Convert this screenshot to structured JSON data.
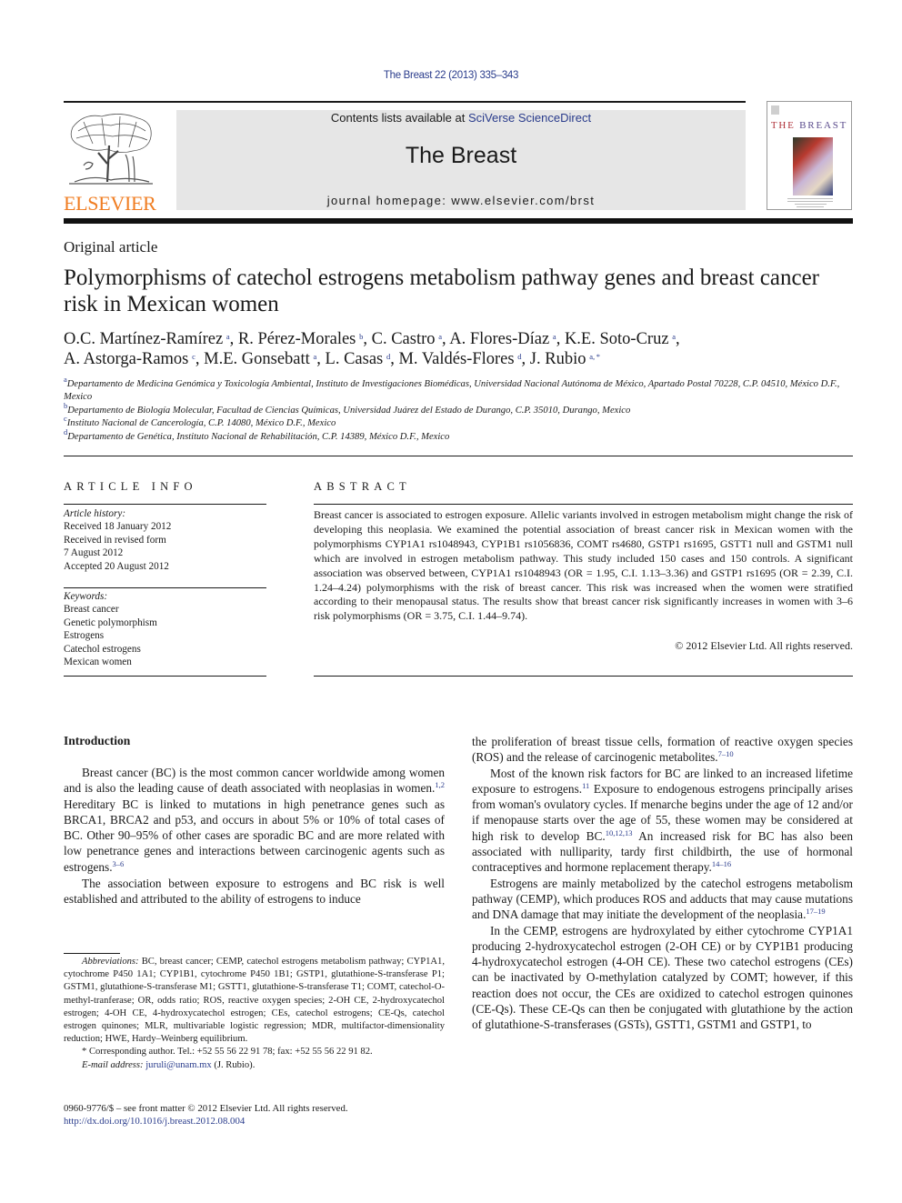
{
  "header": {
    "citation": "The Breast 22 (2013) 335–343",
    "contents_prefix": "Contents lists available at ",
    "contents_link": "SciVerse ScienceDirect",
    "journal_title": "The Breast",
    "homepage": "journal homepage: www.elsevier.com/brst",
    "publisher_logo_text": "ELSEVIER",
    "cover_title_first": "T",
    "cover_title_rest_red": "HE",
    "cover_title_blue": " BREAST",
    "colors": {
      "publisher_orange": "#f07d22",
      "link_blue": "#2a3c8c",
      "banner_gray": "#e6e6e6"
    }
  },
  "article": {
    "type": "Original article",
    "title": "Polymorphisms of catechol estrogens metabolism pathway genes and breast cancer risk in Mexican women",
    "authors": [
      {
        "name": "O.C. Martínez-Ramírez",
        "aff": "a",
        "sep": ", "
      },
      {
        "name": "R. Pérez-Morales",
        "aff": "b",
        "sep": ", "
      },
      {
        "name": "C. Castro",
        "aff": "a",
        "sep": ", "
      },
      {
        "name": "A. Flores-Díaz",
        "aff": "a",
        "sep": ", "
      },
      {
        "name": "K.E. Soto-Cruz",
        "aff": "a",
        "sep": ","
      },
      {
        "name": "A. Astorga-Ramos",
        "aff": "c",
        "sep": ", "
      },
      {
        "name": "M.E. Gonsebatt",
        "aff": "a",
        "sep": ", "
      },
      {
        "name": "L. Casas",
        "aff": "d",
        "sep": ", "
      },
      {
        "name": "M. Valdés-Flores",
        "aff": "d",
        "sep": ", "
      },
      {
        "name": "J. Rubio",
        "aff": "a, *",
        "sep": ""
      }
    ],
    "affiliations": [
      {
        "key": "a",
        "text": "Departamento de Medicina Genómica y Toxicología Ambiental, Instituto de Investigaciones Biomédicas, Universidad Nacional Autónoma de México, Apartado Postal 70228, C.P. 04510, México D.F., Mexico"
      },
      {
        "key": "b",
        "text": "Departamento de Biología Molecular, Facultad de Ciencias Químicas, Universidad Juárez del Estado de Durango, C.P. 35010, Durango, Mexico"
      },
      {
        "key": "c",
        "text": "Instituto Nacional de Cancerología, C.P. 14080, México D.F., Mexico"
      },
      {
        "key": "d",
        "text": "Departamento de Genética, Instituto Nacional de Rehabilitación, C.P. 14389, México D.F., Mexico"
      }
    ]
  },
  "article_info": {
    "heading": "ARTICLE INFO",
    "history_label": "Article history:",
    "history": [
      "Received 18 January 2012",
      "Received in revised form",
      "7 August 2012",
      "Accepted 20 August 2012"
    ],
    "keywords_label": "Keywords:",
    "keywords": [
      "Breast cancer",
      "Genetic polymorphism",
      "Estrogens",
      "Catechol estrogens",
      "Mexican women"
    ]
  },
  "abstract": {
    "heading": "ABSTRACT",
    "text": "Breast cancer is associated to estrogen exposure. Allelic variants involved in estrogen metabolism might change the risk of developing this neoplasia. We examined the potential association of breast cancer risk in Mexican women with the polymorphisms CYP1A1 rs1048943, CYP1B1 rs1056836, COMT rs4680, GSTP1 rs1695, GSTT1 null and GSTM1 null which are involved in estrogen metabolism pathway. This study included 150 cases and 150 controls. A significant association was observed between, CYP1A1 rs1048943 (OR = 1.95, C.I. 1.13–3.36) and GSTP1 rs1695 (OR = 2.39, C.I. 1.24–4.24) polymorphisms with the risk of breast cancer. This risk was increased when the women were stratified according to their menopausal status. The results show that breast cancer risk significantly increases in women with 3–6 risk polymorphisms (OR = 3.75, C.I. 1.44–9.74).",
    "copyright": "© 2012 Elsevier Ltd. All rights reserved."
  },
  "body": {
    "intro_heading": "Introduction",
    "left_paragraphs": [
      [
        {
          "t": "Breast cancer (BC) is the most common cancer worldwide among women and is also the leading cause of death associated with neoplasias in women."
        },
        {
          "ref": "1,2"
        },
        {
          "t": " Hereditary BC is linked to mutations in high penetrance genes such as BRCA1, BRCA2 and p53, and occurs in about 5% or 10% of total cases of BC. Other 90–95% of other cases are sporadic BC and are more related with low pene­trance genes and interactions between carcinogenic agents such as estrogens."
        },
        {
          "ref": "3–6"
        }
      ],
      [
        {
          "t": "The association between exposure to estrogens and BC risk is well established and attributed to the ability of estrogens to induce"
        }
      ]
    ],
    "right_continuation": [
      {
        "t": "the proliferation of breast tissue cells, formation of reactive oxygen species (ROS) and the release of carcinogenic metabolites."
      },
      {
        "ref": "7–10"
      }
    ],
    "right_paragraphs": [
      [
        {
          "t": "Most of the known risk factors for BC are linked to an increased lifetime exposure to estrogens."
        },
        {
          "ref": "11"
        },
        {
          "t": " Exposure to endogenous estro­gens principally arises from woman's ovulatory cycles. If menarche begins under the age of 12 and/or if menopause starts over the age of 55, these women may be considered at high risk to develop BC."
        },
        {
          "ref": "10,12,13"
        },
        {
          "t": " An increased risk for BC has also been associated with nulliparity, tardy first childbirth, the use of hormonal contracep­tives and hormone replacement therapy."
        },
        {
          "ref": "14–16"
        }
      ],
      [
        {
          "t": "Estrogens are mainly metabolized by the catechol estrogens metabolism pathway (CEMP), which produces ROS and adducts that may cause mutations and DNA damage that may initiate the development of the neoplasia."
        },
        {
          "ref": "17–19"
        }
      ],
      [
        {
          "t": "In the CEMP, estrogens are hydroxylated by either cytochrome CYP1A1 producing 2-hydroxycatechol estrogen (2-OH CE) or by CYP1B1 producing 4-hydroxycatechol estrogen (4-OH CE). These two catechol estrogens (CEs) can be inactivated by O-methylation catalyzed by COMT; however, if this reaction does not occur, the CEs are oxidized to catechol estrogen quinones (CE-Qs). These CE-Qs can then be conjugated with glutathione by the action of glutathione-S-transferases (GSTs), GSTT1, GSTM1 and GSTP1, to"
        }
      ]
    ]
  },
  "footnotes": {
    "abbreviations_label": "Abbreviations:",
    "abbreviations": " BC, breast cancer; CEMP, catechol estrogens metabolism pathway; CYP1A1, cytochrome P450 1A1; CYP1B1, cytochrome P450 1B1; GSTP1, glutathione-S-transferase P1; GSTM1, glutathione-S-transferase M1; GSTT1, gluta­thione-S-transferase T1; COMT, catechol-O-methyl-tranferase; OR, odds ratio; ROS, reactive oxygen species; 2-OH CE, 2-hydroxycatechol estrogen; 4-OH CE, 4-hydroxycatechol estrogen; CEs, catechol estrogens; CE-Qs, catechol estrogen quinones; MLR, multivariable logistic regression; MDR, multifactor-dimensionality reduction; HWE, Hardy–Weinberg equilibrium.",
    "corresponding_mark": "*",
    "corresponding": " Corresponding author. Tel.: +52 55 56 22 91 78; fax: +52 55 56 22 91 82.",
    "email_label": "E-mail address:",
    "email": "juruli@unam.mx",
    "email_suffix": " (J. Rubio)."
  },
  "front_matter": {
    "issn_line": "0960-9776/$ – see front matter © 2012 Elsevier Ltd. All rights reserved.",
    "doi": "http://dx.doi.org/10.1016/j.breast.2012.08.004"
  }
}
